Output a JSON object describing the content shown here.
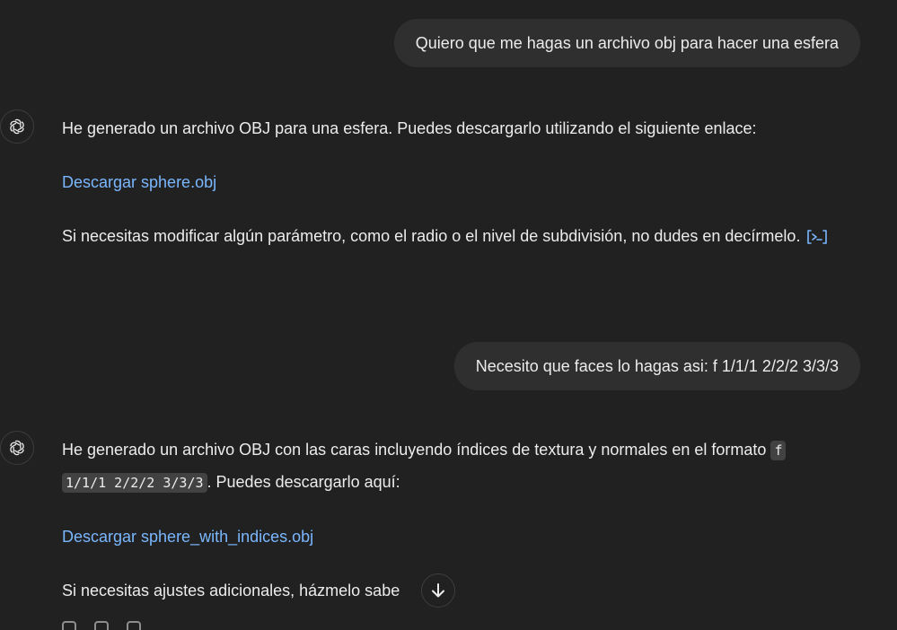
{
  "conversation": {
    "user_message_1": "Quiero que me hagas un archivo obj para hacer una esfera",
    "assistant_message_1": {
      "intro": "He generado un archivo OBJ para una esfera. Puedes descargarlo utilizando el siguiente enlace:",
      "link": "Descargar sphere.obj",
      "outro": "Si necesitas modificar algún parámetro, como el radio o el nivel de subdivisión, no dudes en decírmelo."
    },
    "user_message_2": "Necesito que faces lo hagas asi: f 1/1/1 2/2/2 3/3/3",
    "assistant_message_2": {
      "intro_before_code": "He generado un archivo OBJ con las caras incluyendo índices de textura y normales en el formato",
      "code_line_1": "f",
      "code_line_2": "1/1/1 2/2/2 3/3/3",
      "intro_after_code": ". Puedes descargarlo aquí:",
      "link": "Descargar sphere_with_indices.obj",
      "outro": "Si necesitas ajustes adicionales, házmelo sabe"
    }
  },
  "icons": {
    "assistant_avatar": "openai-logo-icon",
    "citation": "code-interpreter-citation-icon",
    "scroll_down": "arrow-down-icon"
  },
  "colors": {
    "background": "#212121",
    "bubble": "#2f2f2f",
    "link": "#7ab7ff",
    "text": "#ececec"
  }
}
